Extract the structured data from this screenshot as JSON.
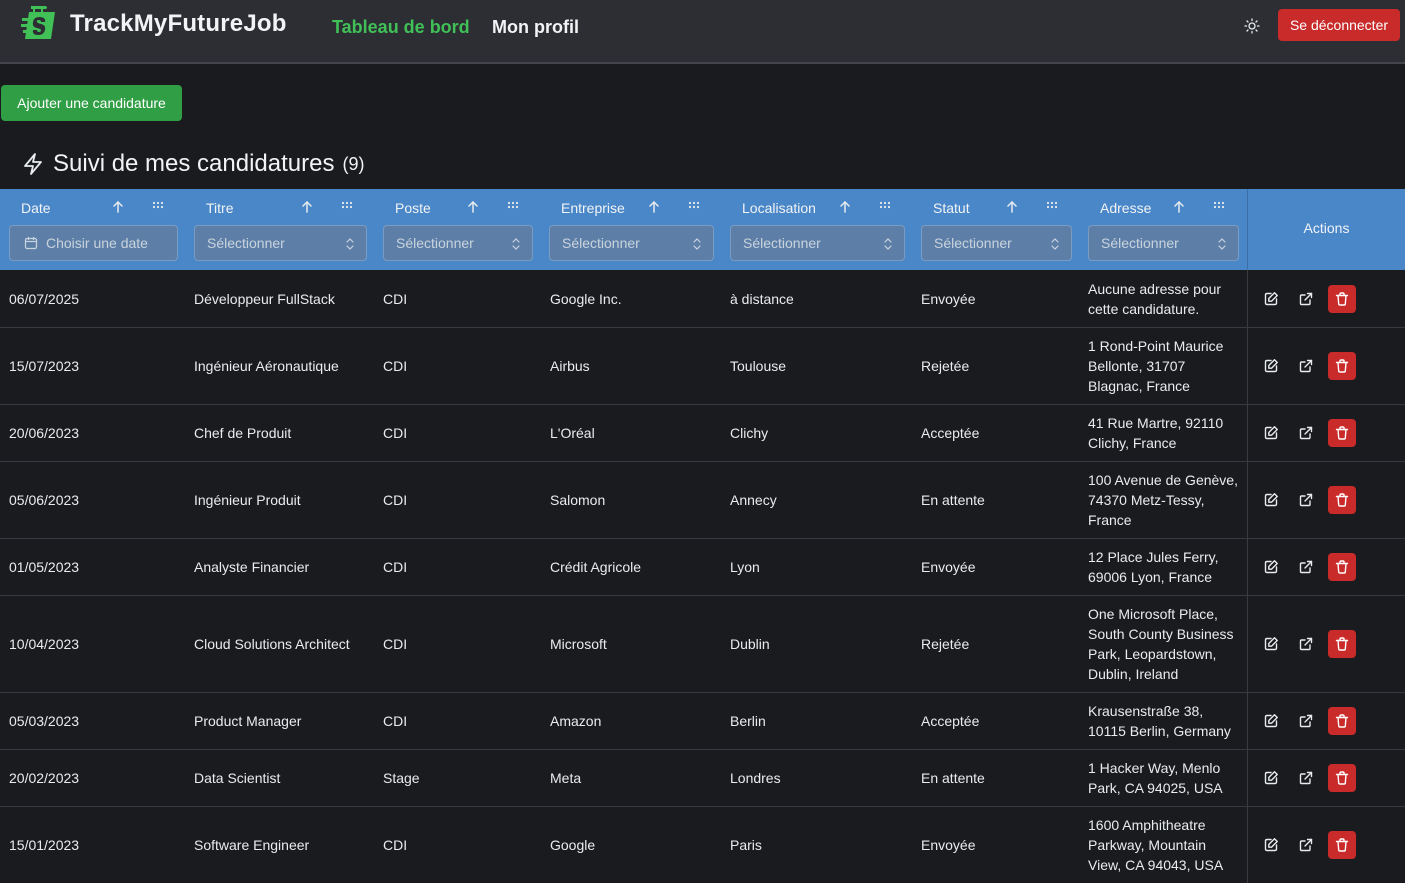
{
  "header": {
    "app_title": "TrackMyFutureJob",
    "nav_dashboard": "Tableau de bord",
    "nav_profile": "Mon profil",
    "logout_label": "Se déconnecter",
    "accent": "#40c057",
    "logo_color": "#40c057"
  },
  "toolbar": {
    "add_label": "Ajouter une candidature"
  },
  "section": {
    "title": "Suivi de mes candidatures",
    "count": "(9)"
  },
  "table": {
    "header_color": "#4a87c8",
    "columns": [
      {
        "key": "date",
        "label": "Date",
        "filter_placeholder": "Choisir une date"
      },
      {
        "key": "title",
        "label": "Titre",
        "filter_placeholder": "Sélectionner"
      },
      {
        "key": "position",
        "label": "Poste",
        "filter_placeholder": "Sélectionner"
      },
      {
        "key": "company",
        "label": "Entreprise",
        "filter_placeholder": "Sélectionner"
      },
      {
        "key": "location",
        "label": "Localisation",
        "filter_placeholder": "Sélectionner"
      },
      {
        "key": "status",
        "label": "Statut",
        "filter_placeholder": "Sélectionner"
      },
      {
        "key": "address",
        "label": "Adresse",
        "filter_placeholder": "Sélectionner"
      }
    ],
    "actions_label": "Actions",
    "rows": [
      {
        "date": "06/07/2025",
        "title": "Développeur FullStack",
        "position": "CDI",
        "company": "Google Inc.",
        "location": "à distance",
        "status": "Envoyée",
        "address": "Aucune adresse pour cette candidature."
      },
      {
        "date": "15/07/2023",
        "title": "Ingénieur Aéronautique",
        "position": "CDI",
        "company": "Airbus",
        "location": "Toulouse",
        "status": "Rejetée",
        "address": "1 Rond-Point Maurice Bellonte, 31707 Blagnac, France"
      },
      {
        "date": "20/06/2023",
        "title": "Chef de Produit",
        "position": "CDI",
        "company": "L'Oréal",
        "location": "Clichy",
        "status": "Acceptée",
        "address": "41 Rue Martre, 92110 Clichy, France"
      },
      {
        "date": "05/06/2023",
        "title": "Ingénieur Produit",
        "position": "CDI",
        "company": "Salomon",
        "location": "Annecy",
        "status": "En attente",
        "address": "100 Avenue de Genève, 74370 Metz-Tessy, France"
      },
      {
        "date": "01/05/2023",
        "title": "Analyste Financier",
        "position": "CDI",
        "company": "Crédit Agricole",
        "location": "Lyon",
        "status": "Envoyée",
        "address": "12 Place Jules Ferry, 69006 Lyon, France"
      },
      {
        "date": "10/04/2023",
        "title": "Cloud Solutions Architect",
        "position": "CDI",
        "company": "Microsoft",
        "location": "Dublin",
        "status": "Rejetée",
        "address": "One Microsoft Place, South County Business Park, Leopardstown, Dublin, Ireland"
      },
      {
        "date": "05/03/2023",
        "title": "Product Manager",
        "position": "CDI",
        "company": "Amazon",
        "location": "Berlin",
        "status": "Acceptée",
        "address": "Krausenstraße 38, 10115 Berlin, Germany"
      },
      {
        "date": "20/02/2023",
        "title": "Data Scientist",
        "position": "Stage",
        "company": "Meta",
        "location": "Londres",
        "status": "En attente",
        "address": "1 Hacker Way, Menlo Park, CA 94025, USA"
      },
      {
        "date": "15/01/2023",
        "title": "Software Engineer",
        "position": "CDI",
        "company": "Google",
        "location": "Paris",
        "status": "Envoyée",
        "address": "1600 Amphitheatre Parkway, Mountain View, CA 94043, USA"
      }
    ]
  },
  "icons": {
    "logo": "shopping-bag-icon",
    "theme": "sun-icon",
    "section": "bolt-icon",
    "sort": "arrow-up-icon",
    "grip": "grip-dots-icon",
    "calendar": "calendar-icon",
    "select": "chevron-up-down-icon",
    "edit": "edit-icon",
    "open": "external-link-icon",
    "delete": "trash-icon"
  }
}
